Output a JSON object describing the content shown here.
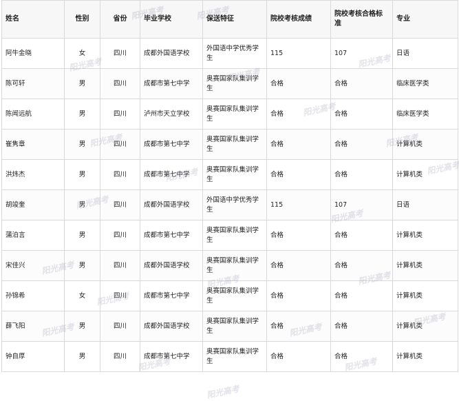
{
  "table": {
    "headers": [
      "姓名",
      "性别",
      "省份",
      "毕业学校",
      "保送特征",
      "院校考核成绩",
      "院校考核合格标准",
      "专业"
    ],
    "rows": [
      [
        "阿牛金晓",
        "女",
        "四川",
        "成都外国语学校",
        "外国语中学优秀学生",
        "115",
        "107",
        "日语"
      ],
      [
        "陈可轩",
        "男",
        "四川",
        "成都市第七中学",
        "奥赛国家队集训学生",
        "合格",
        "合格",
        "临床医学类"
      ],
      [
        "陈闻远航",
        "男",
        "四川",
        "泸州市天立学校",
        "奥赛国家队集训学生",
        "合格",
        "合格",
        "临床医学类"
      ],
      [
        "崔隽章",
        "男",
        "四川",
        "成都市第七中学",
        "奥赛国家队集训学生",
        "合格",
        "合格",
        "计算机类"
      ],
      [
        "洪炜杰",
        "男",
        "四川",
        "成都市第七中学",
        "奥赛国家队集训学生",
        "合格",
        "合格",
        "计算机类"
      ],
      [
        "胡竣奎",
        "男",
        "四川",
        "成都外国语学校",
        "外国语中学优秀学生",
        "115",
        "107",
        "日语"
      ],
      [
        "蒲泊言",
        "男",
        "四川",
        "成都市第七中学",
        "奥赛国家队集训学生",
        "合格",
        "合格",
        "计算机类"
      ],
      [
        "宋佳兴",
        "男",
        "四川",
        "成都外国语学校",
        "奥赛国家队集训学生",
        "合格",
        "合格",
        "计算机类"
      ],
      [
        "孙锦希",
        "女",
        "四川",
        "成都市第七中学",
        "奥赛国家队集训学生",
        "合格",
        "合格",
        "计算机类"
      ],
      [
        "薛飞阳",
        "男",
        "四川",
        "成都外国语学校",
        "奥赛国家队集训学生",
        "合格",
        "合格",
        "计算机类"
      ],
      [
        "钟自厚",
        "男",
        "四川",
        "成都市第七中学",
        "奥赛国家队集训学生",
        "合格",
        "合格",
        "计算机类"
      ]
    ]
  },
  "watermark": "阳光高考"
}
